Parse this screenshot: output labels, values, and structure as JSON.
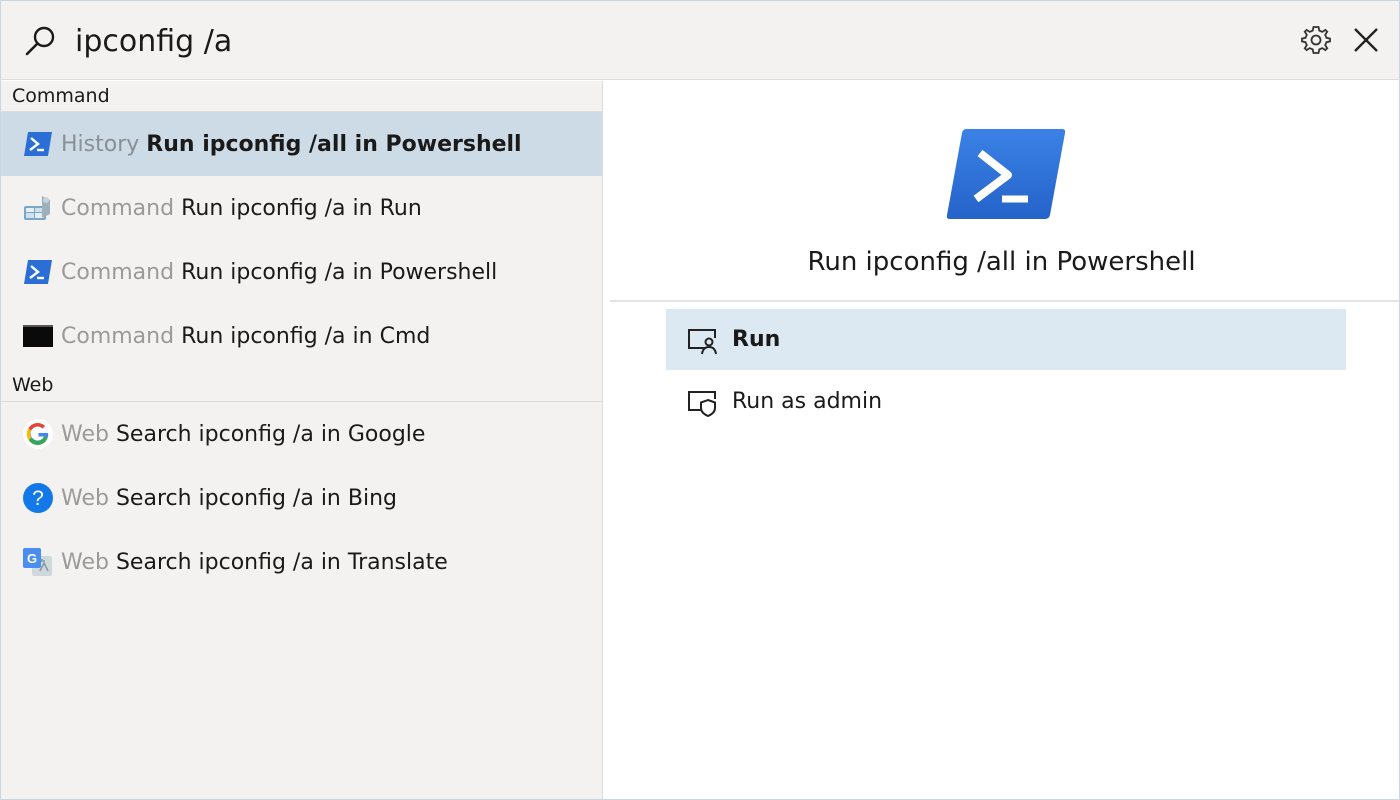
{
  "search": {
    "query": "ipconfig /a"
  },
  "header": {
    "settings_icon": "gear-icon",
    "close_icon": "close-icon"
  },
  "groups": [
    {
      "label": "Command",
      "items": [
        {
          "type": "History",
          "title": "Run ipconfig /all in Powershell",
          "icon": "powershell-icon",
          "selected": true
        },
        {
          "type": "Command",
          "title": "Run ipconfig /a in Run",
          "icon": "run-dialog-icon",
          "selected": false
        },
        {
          "type": "Command",
          "title": "Run ipconfig /a in Powershell",
          "icon": "powershell-icon",
          "selected": false
        },
        {
          "type": "Command",
          "title": "Run ipconfig /a in Cmd",
          "icon": "cmd-icon",
          "selected": false
        }
      ]
    },
    {
      "label": "Web",
      "items": [
        {
          "type": "Web",
          "title": "Search ipconfig /a in Google",
          "icon": "google-icon",
          "selected": false
        },
        {
          "type": "Web",
          "title": "Search ipconfig /a in Bing",
          "icon": "bing-help-icon",
          "selected": false
        },
        {
          "type": "Web",
          "title": "Search ipconfig /a in Translate",
          "icon": "translate-icon",
          "selected": false
        }
      ]
    }
  ],
  "preview": {
    "title": "Run ipconfig /all in Powershell",
    "icon": "powershell-icon",
    "actions": [
      {
        "label": "Run",
        "icon": "run-user-icon",
        "selected": true
      },
      {
        "label": "Run as admin",
        "icon": "run-admin-shield-icon",
        "selected": false
      }
    ]
  },
  "colors": {
    "selected_row": "#cddbe6",
    "selected_action": "#dce8f2",
    "panel_bg": "#f3f2f1",
    "powershell_blue": "#2b6fd6"
  }
}
